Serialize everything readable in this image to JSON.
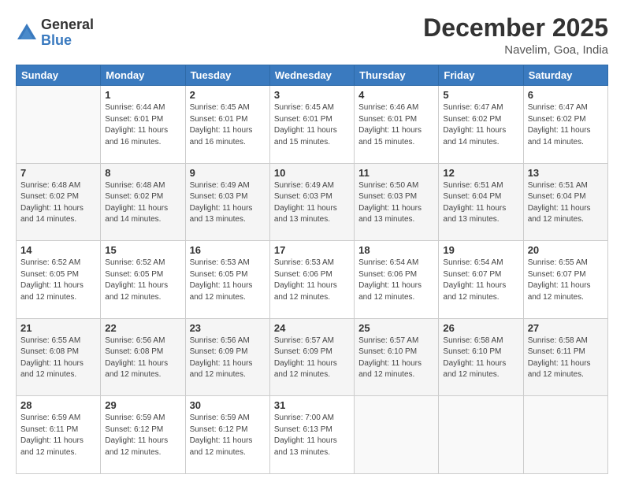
{
  "logo": {
    "general": "General",
    "blue": "Blue"
  },
  "header": {
    "month": "December 2025",
    "location": "Navelim, Goa, India"
  },
  "weekdays": [
    "Sunday",
    "Monday",
    "Tuesday",
    "Wednesday",
    "Thursday",
    "Friday",
    "Saturday"
  ],
  "weeks": [
    [
      {
        "day": "",
        "info": ""
      },
      {
        "day": "1",
        "info": "Sunrise: 6:44 AM\nSunset: 6:01 PM\nDaylight: 11 hours\nand 16 minutes."
      },
      {
        "day": "2",
        "info": "Sunrise: 6:45 AM\nSunset: 6:01 PM\nDaylight: 11 hours\nand 16 minutes."
      },
      {
        "day": "3",
        "info": "Sunrise: 6:45 AM\nSunset: 6:01 PM\nDaylight: 11 hours\nand 15 minutes."
      },
      {
        "day": "4",
        "info": "Sunrise: 6:46 AM\nSunset: 6:01 PM\nDaylight: 11 hours\nand 15 minutes."
      },
      {
        "day": "5",
        "info": "Sunrise: 6:47 AM\nSunset: 6:02 PM\nDaylight: 11 hours\nand 14 minutes."
      },
      {
        "day": "6",
        "info": "Sunrise: 6:47 AM\nSunset: 6:02 PM\nDaylight: 11 hours\nand 14 minutes."
      }
    ],
    [
      {
        "day": "7",
        "info": "Sunrise: 6:48 AM\nSunset: 6:02 PM\nDaylight: 11 hours\nand 14 minutes."
      },
      {
        "day": "8",
        "info": "Sunrise: 6:48 AM\nSunset: 6:02 PM\nDaylight: 11 hours\nand 14 minutes."
      },
      {
        "day": "9",
        "info": "Sunrise: 6:49 AM\nSunset: 6:03 PM\nDaylight: 11 hours\nand 13 minutes."
      },
      {
        "day": "10",
        "info": "Sunrise: 6:49 AM\nSunset: 6:03 PM\nDaylight: 11 hours\nand 13 minutes."
      },
      {
        "day": "11",
        "info": "Sunrise: 6:50 AM\nSunset: 6:03 PM\nDaylight: 11 hours\nand 13 minutes."
      },
      {
        "day": "12",
        "info": "Sunrise: 6:51 AM\nSunset: 6:04 PM\nDaylight: 11 hours\nand 13 minutes."
      },
      {
        "day": "13",
        "info": "Sunrise: 6:51 AM\nSunset: 6:04 PM\nDaylight: 11 hours\nand 12 minutes."
      }
    ],
    [
      {
        "day": "14",
        "info": "Sunrise: 6:52 AM\nSunset: 6:05 PM\nDaylight: 11 hours\nand 12 minutes."
      },
      {
        "day": "15",
        "info": "Sunrise: 6:52 AM\nSunset: 6:05 PM\nDaylight: 11 hours\nand 12 minutes."
      },
      {
        "day": "16",
        "info": "Sunrise: 6:53 AM\nSunset: 6:05 PM\nDaylight: 11 hours\nand 12 minutes."
      },
      {
        "day": "17",
        "info": "Sunrise: 6:53 AM\nSunset: 6:06 PM\nDaylight: 11 hours\nand 12 minutes."
      },
      {
        "day": "18",
        "info": "Sunrise: 6:54 AM\nSunset: 6:06 PM\nDaylight: 11 hours\nand 12 minutes."
      },
      {
        "day": "19",
        "info": "Sunrise: 6:54 AM\nSunset: 6:07 PM\nDaylight: 11 hours\nand 12 minutes."
      },
      {
        "day": "20",
        "info": "Sunrise: 6:55 AM\nSunset: 6:07 PM\nDaylight: 11 hours\nand 12 minutes."
      }
    ],
    [
      {
        "day": "21",
        "info": "Sunrise: 6:55 AM\nSunset: 6:08 PM\nDaylight: 11 hours\nand 12 minutes."
      },
      {
        "day": "22",
        "info": "Sunrise: 6:56 AM\nSunset: 6:08 PM\nDaylight: 11 hours\nand 12 minutes."
      },
      {
        "day": "23",
        "info": "Sunrise: 6:56 AM\nSunset: 6:09 PM\nDaylight: 11 hours\nand 12 minutes."
      },
      {
        "day": "24",
        "info": "Sunrise: 6:57 AM\nSunset: 6:09 PM\nDaylight: 11 hours\nand 12 minutes."
      },
      {
        "day": "25",
        "info": "Sunrise: 6:57 AM\nSunset: 6:10 PM\nDaylight: 11 hours\nand 12 minutes."
      },
      {
        "day": "26",
        "info": "Sunrise: 6:58 AM\nSunset: 6:10 PM\nDaylight: 11 hours\nand 12 minutes."
      },
      {
        "day": "27",
        "info": "Sunrise: 6:58 AM\nSunset: 6:11 PM\nDaylight: 11 hours\nand 12 minutes."
      }
    ],
    [
      {
        "day": "28",
        "info": "Sunrise: 6:59 AM\nSunset: 6:11 PM\nDaylight: 11 hours\nand 12 minutes."
      },
      {
        "day": "29",
        "info": "Sunrise: 6:59 AM\nSunset: 6:12 PM\nDaylight: 11 hours\nand 12 minutes."
      },
      {
        "day": "30",
        "info": "Sunrise: 6:59 AM\nSunset: 6:12 PM\nDaylight: 11 hours\nand 12 minutes."
      },
      {
        "day": "31",
        "info": "Sunrise: 7:00 AM\nSunset: 6:13 PM\nDaylight: 11 hours\nand 13 minutes."
      },
      {
        "day": "",
        "info": ""
      },
      {
        "day": "",
        "info": ""
      },
      {
        "day": "",
        "info": ""
      }
    ]
  ]
}
